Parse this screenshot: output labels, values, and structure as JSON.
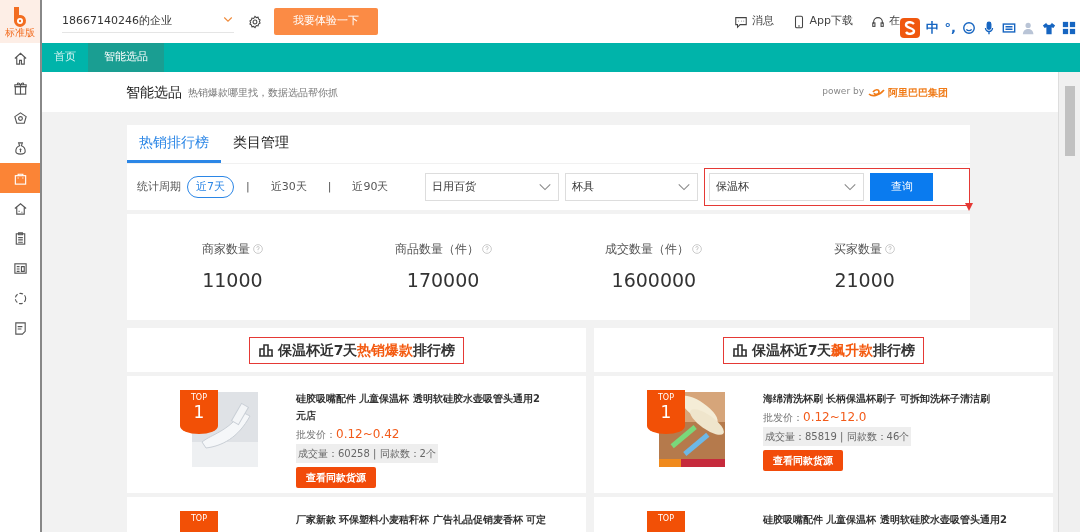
{
  "logo": {
    "caption": "标准版"
  },
  "header": {
    "company": "18667140246的企业",
    "try_button": "我要体验一下",
    "links": [
      {
        "kind": "message",
        "label": "消息"
      },
      {
        "kind": "phone",
        "label": "App下载"
      },
      {
        "kind": "headset",
        "label": "在"
      }
    ]
  },
  "ime_toolbar": {
    "mode": "中",
    "punct": "°,"
  },
  "sidebar": {
    "items": [
      {
        "selected": false
      },
      {
        "selected": false
      },
      {
        "selected": false
      },
      {
        "selected": false
      },
      {
        "selected": true
      },
      {
        "selected": false
      },
      {
        "selected": false
      },
      {
        "selected": false
      },
      {
        "selected": false
      },
      {
        "selected": false
      }
    ]
  },
  "nav_tabs": [
    {
      "label": "首页",
      "selected": false
    },
    {
      "label": "智能选品",
      "selected": true
    }
  ],
  "page_title": {
    "title": "智能选品",
    "slogan": "热销爆款哪里找，数据选品帮你抓",
    "powered_by": "power by",
    "brand": "阿里巴巴集团"
  },
  "tabs": [
    {
      "label": "热销排行榜",
      "selected": true
    },
    {
      "label": "类目管理",
      "selected": false
    }
  ],
  "filters": {
    "period_label": "统计周期",
    "separators": [
      "|",
      "|"
    ],
    "periods": [
      {
        "label": "近7天",
        "selected": true
      },
      {
        "label": "近30天",
        "selected": false
      },
      {
        "label": "近90天",
        "selected": false
      }
    ],
    "selects": [
      {
        "value": "日用百货",
        "highlighted": false
      },
      {
        "value": "杯具",
        "highlighted": false
      },
      {
        "value": "保温杯",
        "highlighted": true
      }
    ],
    "query_button": "查询"
  },
  "stats": [
    {
      "label": "商家数量",
      "value": "11000"
    },
    {
      "label": "商品数量（件）",
      "value": "170000"
    },
    {
      "label": "成交数量（件）",
      "value": "1600000"
    },
    {
      "label": "买家数量",
      "value": "21000"
    }
  ],
  "rankings": [
    {
      "title_parts": [
        {
          "text": "保温杯近7天",
          "highlight": false
        },
        {
          "text": "热销爆款",
          "highlight": true
        },
        {
          "text": "排行榜",
          "highlight": false
        }
      ],
      "items": [
        {
          "rank_label": "TOP",
          "rank": "1",
          "title": "硅胶吸嘴配件 儿童保温杯 透明软硅胶水壶吸管头通用2元店",
          "price_label": "批发价：",
          "price": "0.12~0.42",
          "sales": "成交量：60258 | 同款数：2个",
          "button": "查看同款货源"
        },
        {
          "rank_label": "TOP",
          "title": "厂家新款 环保塑料小麦秸秆杯 广告礼品促销麦香杯 可定"
        }
      ]
    },
    {
      "title_parts": [
        {
          "text": "保温杯近7天",
          "highlight": false
        },
        {
          "text": "飙升款",
          "highlight": true
        },
        {
          "text": "排行榜",
          "highlight": false
        }
      ],
      "items": [
        {
          "rank_label": "TOP",
          "rank": "1",
          "title": "海绵清洗杯刷 长柄保温杯刷子 可拆卸洗杯子清洁刷",
          "price_label": "批发价：",
          "price": "0.12~12.0",
          "sales": "成交量：85819 | 同款数：46个",
          "button": "查看同款货源"
        },
        {
          "rank_label": "TOP",
          "title": "硅胶吸嘴配件 儿童保温杯 透明软硅胶水壶吸管头通用2"
        }
      ]
    }
  ]
}
